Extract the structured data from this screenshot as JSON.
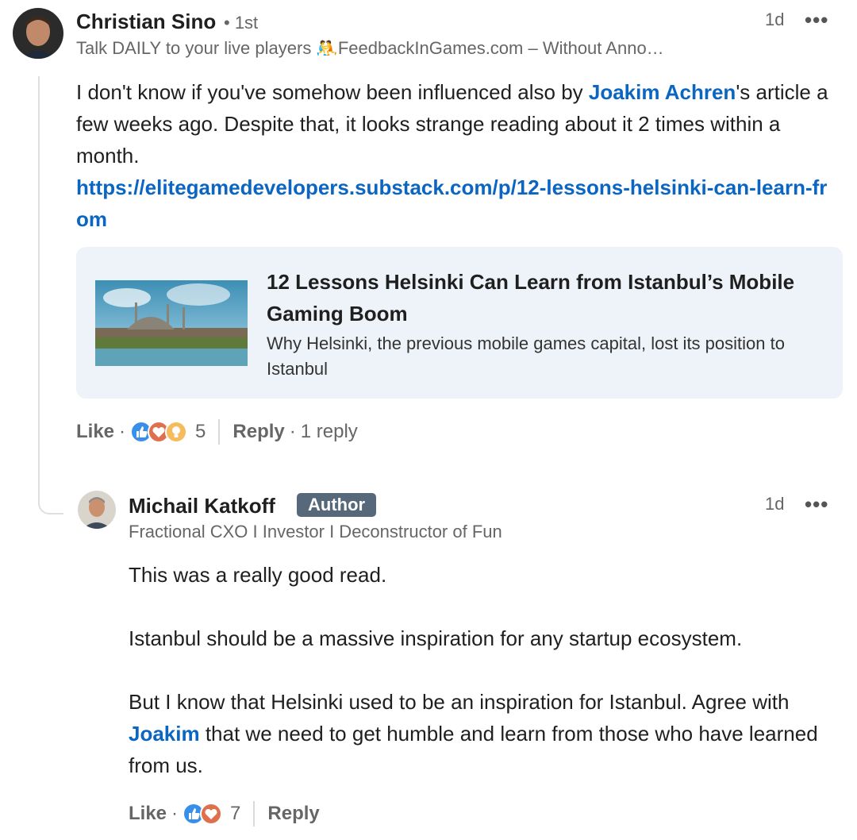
{
  "comment": {
    "author_name": "Christian Sino",
    "degree": "• 1st",
    "headline": "Talk DAILY to your live players 🤼FeedbackInGames.com – Without Anno…",
    "time": "1d",
    "more_label": "•••",
    "text_part1": "I don't know if you've somehow been influenced also by ",
    "mention": "Joakim Achren",
    "text_part2": "'s article a few weeks ago. Despite that, it looks strange reading about it 2 times within a month.",
    "link": "https://elitegamedevelopers.substack.com/p/12-lessons-helsinki-can-learn-from",
    "preview": {
      "title": "12 Lessons Helsinki Can Learn from Istanbul’s Mobile Gaming Boom",
      "subtitle": "Why Helsinki, the previous mobile games capital, lost its position to Istanbul"
    },
    "like_label": "Like",
    "reaction_count": "5",
    "reply_label": "Reply",
    "replies_count": "1 reply"
  },
  "reply": {
    "author_name": "Michail Katkoff",
    "badge": "Author",
    "headline": "Fractional CXO I Investor I Deconstructor of Fun",
    "time": "1d",
    "more_label": "•••",
    "para1": "This was a really good read.",
    "para2": "Istanbul should be a massive inspiration for any startup ecosystem.",
    "para3_part1": "But I know that Helsinki used to be an inspiration for Istanbul. Agree with ",
    "mention": "Joakim",
    "para3_part2": " that we need to get humble and learn from those who have learned from us.",
    "like_label": "Like",
    "reaction_count": "7",
    "reply_label": "Reply"
  },
  "colors": {
    "link": "#0a66c2",
    "card_bg": "#edf3f8",
    "badge_bg": "#56687a"
  }
}
